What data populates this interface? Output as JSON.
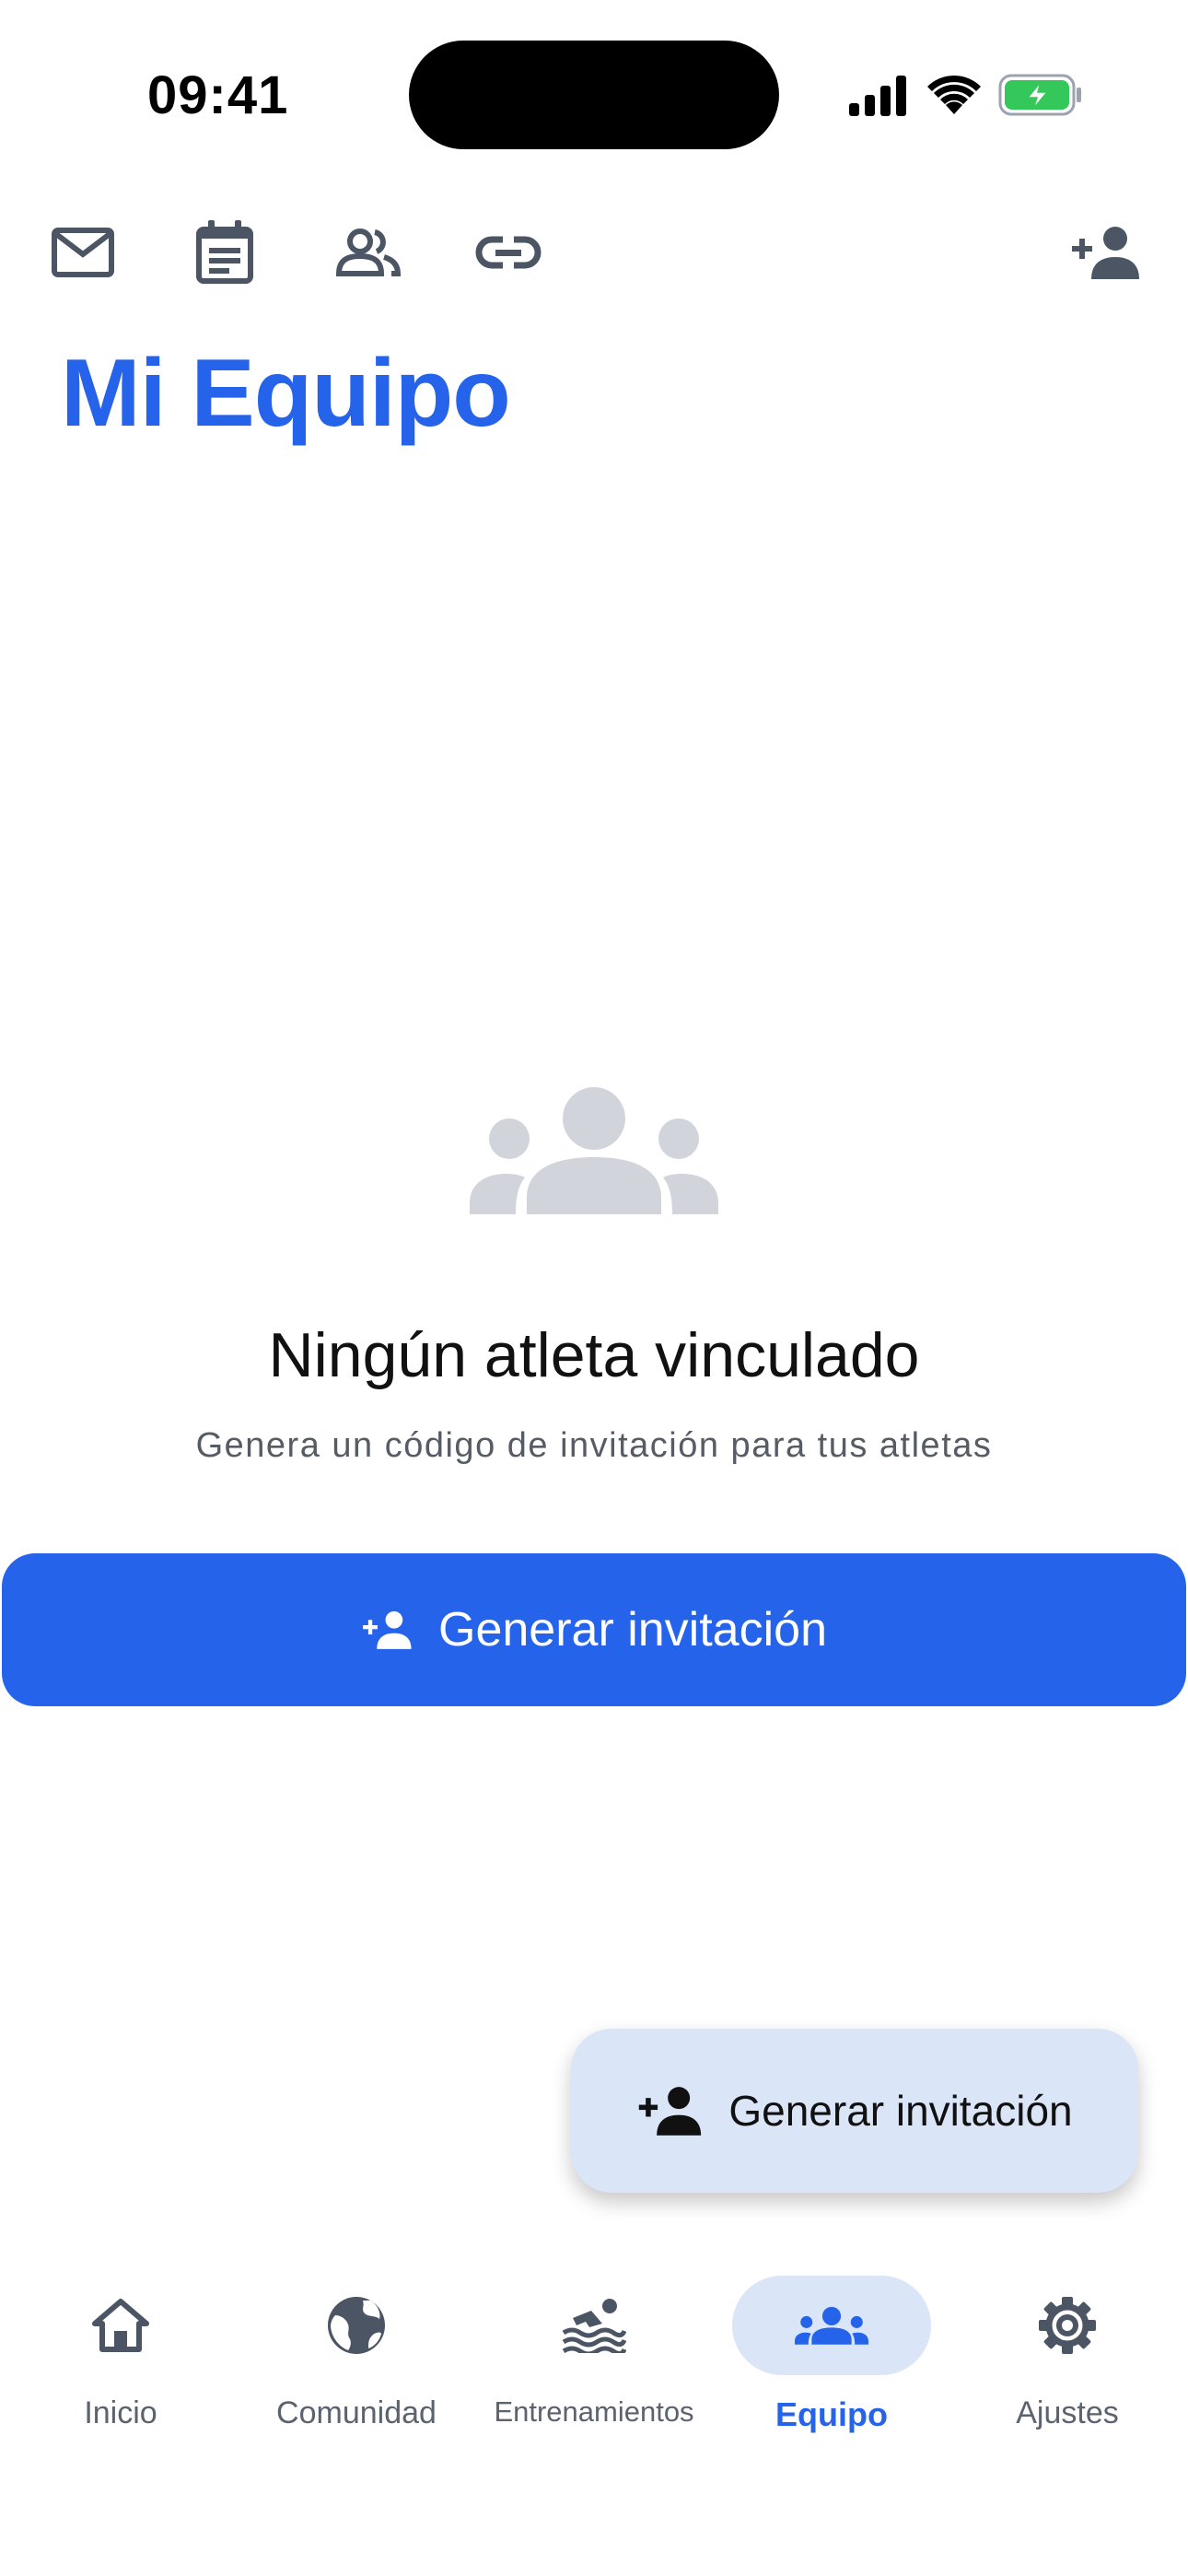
{
  "status_bar": {
    "time": "09:41"
  },
  "toolbar": {
    "icons": [
      "mail-icon",
      "notes-icon",
      "people-icon",
      "link-icon",
      "add-person-icon"
    ]
  },
  "page": {
    "title": "Mi Equipo"
  },
  "empty_state": {
    "icon": "group-icon",
    "title": "Ningún atleta vinculado",
    "subtitle": "Genera un código de invitación para tus atletas"
  },
  "primary_button": {
    "label": "Generar invitación",
    "icon": "add-person-icon"
  },
  "fab": {
    "label": "Generar invitación",
    "icon": "add-person-icon"
  },
  "bottom_nav": {
    "items": [
      {
        "label": "Inicio",
        "icon": "home-icon",
        "active": false
      },
      {
        "label": "Comunidad",
        "icon": "globe-icon",
        "active": false
      },
      {
        "label": "Entrenamientos",
        "icon": "swimming-icon",
        "active": false
      },
      {
        "label": "Equipo",
        "icon": "group-icon",
        "active": true
      },
      {
        "label": "Ajustes",
        "icon": "gear-icon",
        "active": false
      }
    ]
  },
  "colors": {
    "accent": "#2563eb",
    "accent_light": "#dbe5f8",
    "icon_gray": "#4b5563",
    "empty_icon": "#d1d5db",
    "battery_green": "#34c759"
  }
}
